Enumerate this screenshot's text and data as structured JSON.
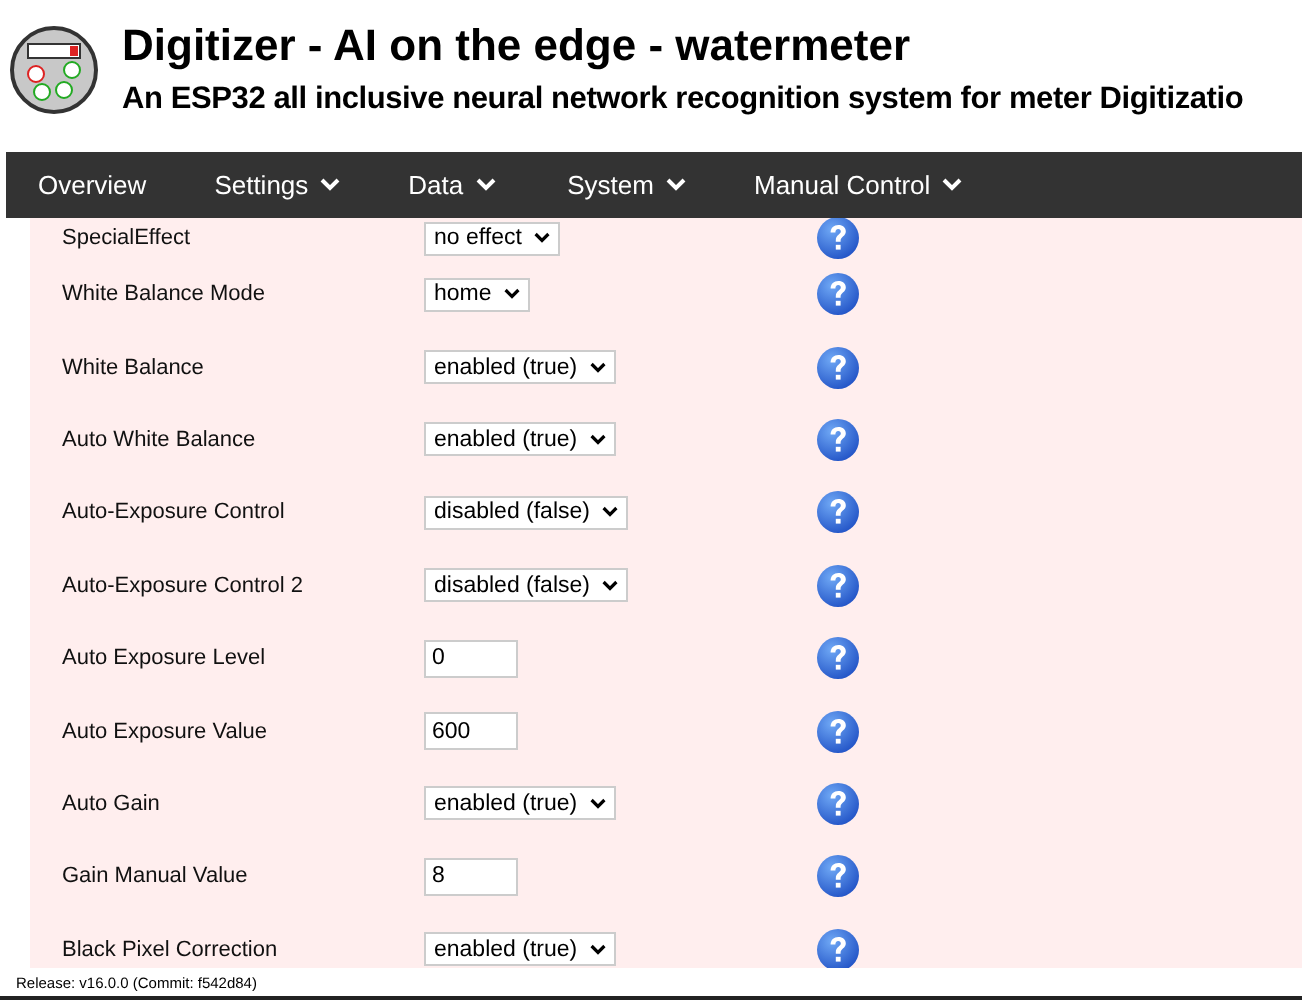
{
  "header": {
    "title": "Digitizer - AI on the edge - watermeter",
    "subtitle": "An ESP32 all inclusive neural network recognition system for meter Digitizatio"
  },
  "nav": [
    {
      "label": "Overview",
      "dropdown": false
    },
    {
      "label": "Settings",
      "dropdown": true
    },
    {
      "label": "Data",
      "dropdown": true
    },
    {
      "label": "System",
      "dropdown": true
    },
    {
      "label": "Manual Control",
      "dropdown": true
    }
  ],
  "settings": [
    {
      "label": "SpecialEffect",
      "kind": "select",
      "value": "no effect"
    },
    {
      "label": "White Balance Mode",
      "kind": "select",
      "value": "home"
    },
    {
      "label": "White Balance",
      "kind": "select",
      "value": "enabled (true)"
    },
    {
      "label": "Auto White Balance",
      "kind": "select",
      "value": "enabled (true)"
    },
    {
      "label": "Auto-Exposure Control",
      "kind": "select",
      "value": "disabled (false)"
    },
    {
      "label": "Auto-Exposure Control 2",
      "kind": "select",
      "value": "disabled (false)"
    },
    {
      "label": "Auto Exposure Level",
      "kind": "input",
      "value": "0"
    },
    {
      "label": "Auto Exposure Value",
      "kind": "input",
      "value": "600"
    },
    {
      "label": "Auto Gain",
      "kind": "select",
      "value": "enabled (true)"
    },
    {
      "label": "Gain Manual Value",
      "kind": "input",
      "value": "8"
    },
    {
      "label": "Black Pixel Correction",
      "kind": "select",
      "value": "enabled (true)"
    }
  ],
  "footer": {
    "release": "Release: v16.0.0 (Commit: f542d84)"
  }
}
